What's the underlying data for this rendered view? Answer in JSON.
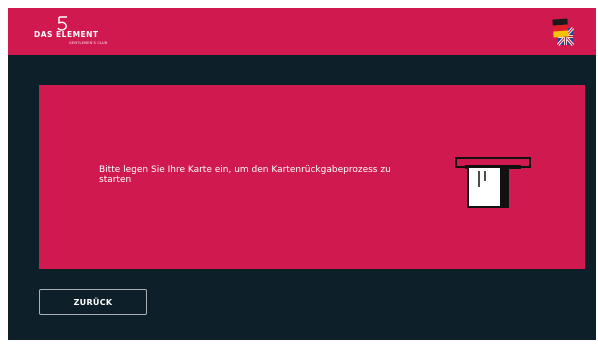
{
  "header": {
    "logo_main": "DAS ELEMENT",
    "logo_sub": "GENTLEMEN'S CLUB",
    "language_icon": "language-flag-de-en-icon",
    "accent_color": "#d0194f"
  },
  "main": {
    "message": "Bitte legen Sie Ihre Karte ein, um den Kartenrückgabeprozess zu starten",
    "illustration_icon": "card-insert-icon"
  },
  "footer": {
    "back_label": "ZURÜCK"
  },
  "colors": {
    "background": "#0d1f28",
    "accent": "#d0194f",
    "text": "#ffffff"
  }
}
